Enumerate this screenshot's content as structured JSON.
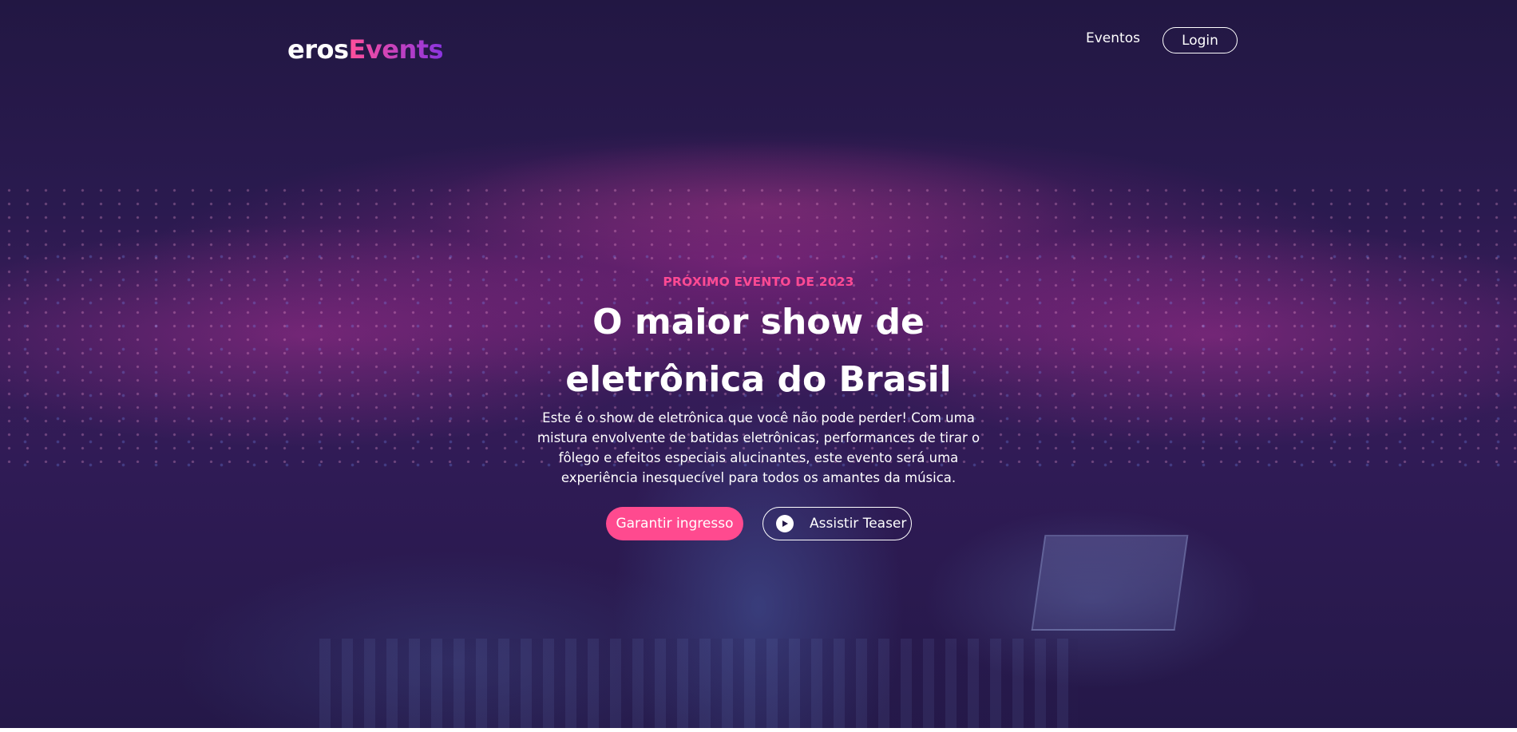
{
  "brand": {
    "logo_part1": "eros",
    "logo_part2": "Events"
  },
  "nav": {
    "events_link": "Eventos",
    "login_button": "Login"
  },
  "hero": {
    "eyebrow": "PRÓXIMO EVENTO DE 2023",
    "headline_line1": "O maior show de",
    "headline_line2": "eletrônica do Brasil",
    "description": "Este é o show de eletrônica que você não pode perder! Com uma mistura envolvente de batidas eletrônicas, performances de tirar o fôlego e efeitos especiais alucinantes, este evento será uma experiência inesquecível para todos os amantes da música.",
    "primary_cta": "Garantir ingresso",
    "secondary_cta": "Assistir Teaser"
  },
  "colors": {
    "accent_pink": "#ff4a8f",
    "accent_purple": "#8a34e0",
    "background": "#241848"
  },
  "icons": {
    "teaser_icon": "play-circle-icon"
  }
}
